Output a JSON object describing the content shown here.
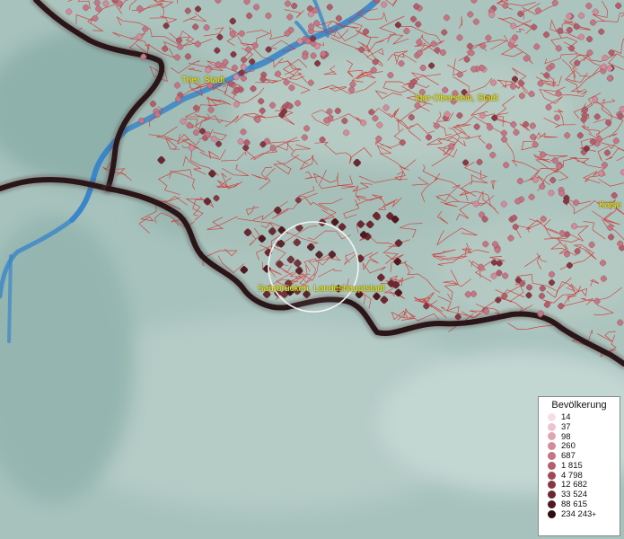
{
  "map": {
    "cities": [
      {
        "name": "Trier, Stadt"
      },
      {
        "name": "Idar-Oberstein, Stadt"
      },
      {
        "name": "Saarbrücken, Landeshauptstadt"
      },
      {
        "name": "Kaise"
      }
    ]
  },
  "legend": {
    "title": "Bevölkerung",
    "items": [
      {
        "label": "14",
        "color": "#f7dde8"
      },
      {
        "label": "37",
        "color": "#eec2d0"
      },
      {
        "label": "98",
        "color": "#e0a3b4"
      },
      {
        "label": "260",
        "color": "#d48c9c"
      },
      {
        "label": "687",
        "color": "#c67584"
      },
      {
        "label": "1 815",
        "color": "#b45e6c"
      },
      {
        "label": "4 798",
        "color": "#9e4a56"
      },
      {
        "label": "12 682",
        "color": "#863842"
      },
      {
        "label": "33 524",
        "color": "#6c2830"
      },
      {
        "label": "88 615",
        "color": "#4e1a20"
      },
      {
        "label": "234 243",
        "suffix": "+",
        "color": "#2e0c10"
      }
    ]
  },
  "colors": {
    "land": "#a8c2bd",
    "border": "#2a1618",
    "district": "#d23030",
    "water": "#3a86c8"
  }
}
